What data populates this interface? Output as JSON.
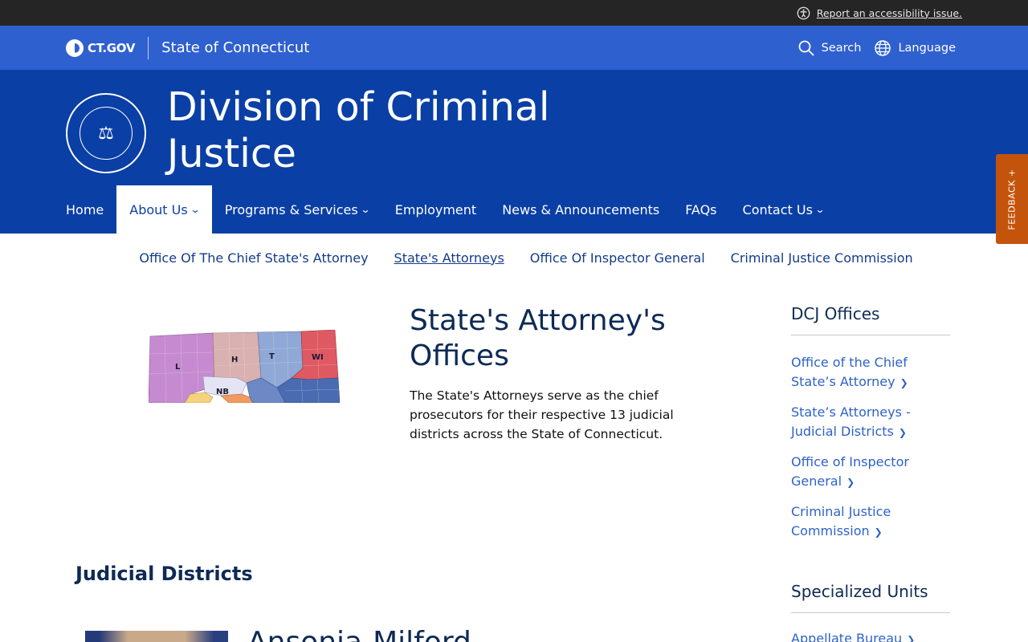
{
  "utility": {
    "accessibility_link": "Report an accessibility issue."
  },
  "gov_bar": {
    "logo_text": "CT.GOV",
    "state_name": "State of Connecticut",
    "search_label": "Search",
    "language_label": "Language"
  },
  "agency": {
    "title_line1": "Division of Criminal",
    "title_line2": "Justice"
  },
  "nav": {
    "items": [
      {
        "label": "Home"
      },
      {
        "label": "About Us"
      },
      {
        "label": "Programs & Services"
      },
      {
        "label": "Employment"
      },
      {
        "label": "News & Announcements"
      },
      {
        "label": "FAQs"
      },
      {
        "label": "Contact Us"
      }
    ]
  },
  "subnav": {
    "items": [
      {
        "label": "Office Of The Chief State's Attorney"
      },
      {
        "label": "State's Attorneys"
      },
      {
        "label": "Office Of Inspector General"
      },
      {
        "label": "Criminal Justice Commission"
      }
    ]
  },
  "feedback_tab": "FEEDBACK +",
  "map": {
    "labels": [
      "L",
      "H",
      "T",
      "WI",
      "NB"
    ]
  },
  "main": {
    "title_line1": "State's Attorney's",
    "title_line2": "Offices",
    "intro": "The State's Attorneys serve as the chief prosecutors for their respective 13 judicial districts across the State of Connecticut.",
    "section_heading": "Judicial Districts",
    "next_card_title": "Ansonia-Milford"
  },
  "sidebar": {
    "offices_heading": "DCJ Offices",
    "office_links": [
      {
        "line1": "Office of the Chief",
        "line2": "State’s Attorney"
      },
      {
        "line1": "State’s Attorneys -",
        "line2": "Judicial Districts"
      },
      {
        "line1": "Office of Inspector",
        "line2": "General"
      },
      {
        "line1": "Criminal Justice",
        "line2": "Commission"
      }
    ],
    "units_heading": "Specialized Units",
    "unit_links": [
      {
        "label": "Appellate Bureau"
      }
    ]
  },
  "colors": {
    "gov_blue": "#2f60cf",
    "agency_blue": "#0a3fa5",
    "feedback": "#c4540c",
    "link": "#2e62c8"
  }
}
